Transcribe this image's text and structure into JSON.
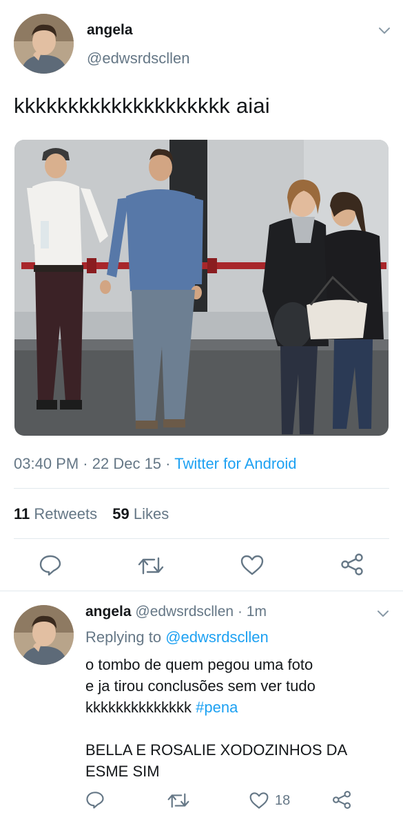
{
  "tweet": {
    "author": {
      "name": "angela",
      "handle": "@edwsrdscllen",
      "avatar_icon": "profile-photo"
    },
    "text": "kkkkkkkkkkkkkkkkkkkk aiai",
    "meta": {
      "time": "03:40 PM",
      "sep1": "·",
      "date": "22 Dec 15",
      "sep2": "·",
      "source": "Twitter for Android"
    },
    "stats": {
      "retweets_count": "11",
      "retweets_label": "Retweets",
      "likes_count": "59",
      "likes_label": "Likes"
    },
    "actions": [
      "reply-icon",
      "retweet-icon",
      "like-icon",
      "share-icon"
    ]
  },
  "reply": {
    "author": {
      "name": "angela",
      "handle": "@edwsrdscllen",
      "sep": "·",
      "time": "1m"
    },
    "replying_prefix": "Replying to",
    "replying_to": "@edwsrdscllen",
    "lines": [
      "o tombo de quem pegou uma foto",
      "e ja tirou conclusões sem ver tudo"
    ],
    "line3_text": "kkkkkkkkkkkkkk",
    "hashtag": "#pena",
    "lines2": [
      "BELLA E ROSALIE XODOZINHOS DA",
      "ESME SIM"
    ],
    "like_count": "18"
  },
  "colors": {
    "accent": "#1da1f2",
    "muted": "#657786",
    "divider": "#e1e8ed"
  }
}
